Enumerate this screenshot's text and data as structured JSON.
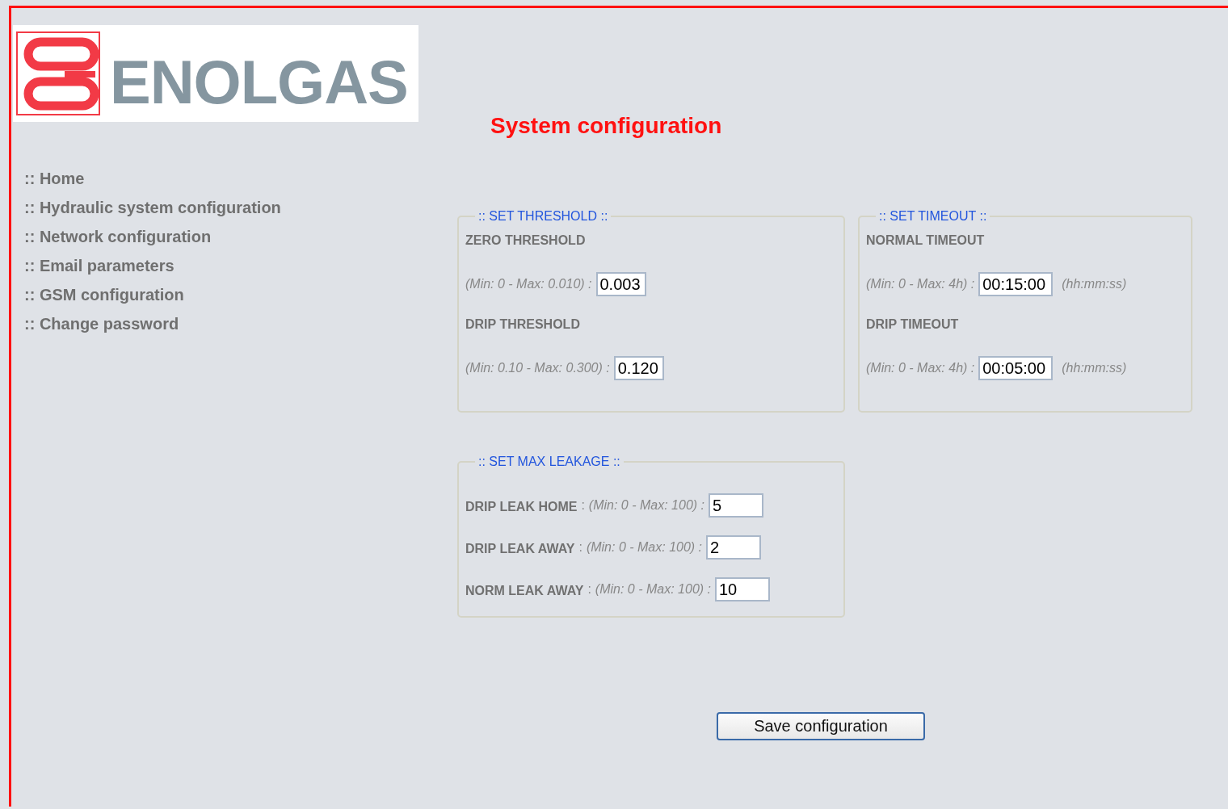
{
  "logo": {
    "text": "ENOLGAS"
  },
  "title": "System configuration",
  "nav": [
    {
      "label": ":: Home"
    },
    {
      "label": ":: Hydraulic system configuration"
    },
    {
      "label": ":: Network configuration"
    },
    {
      "label": ":: Email parameters"
    },
    {
      "label": ":: GSM configuration"
    },
    {
      "label": ":: Change password"
    }
  ],
  "sections": [
    {
      "legend": ":: SET THRESHOLD ::",
      "kind": "stacked",
      "fields": [
        {
          "label": "ZERO THRESHOLD",
          "hint": "(Min: 0 - Max: 0.010) :",
          "value": "0.003"
        },
        {
          "label": "DRIP THRESHOLD",
          "hint": "(Min: 0.10 - Max: 0.300) :",
          "value": "0.120"
        }
      ]
    },
    {
      "legend": ":: SET TIMEOUT ::",
      "kind": "stacked",
      "fields": [
        {
          "label": "NORMAL TIMEOUT",
          "hint": "(Min: 0 - Max: 4h) :",
          "value": "00:15:00",
          "unit": "(hh:mm:ss)"
        },
        {
          "label": "DRIP TIMEOUT",
          "hint": "(Min: 0 - Max: 4h) :",
          "value": "00:05:00",
          "unit": "(hh:mm:ss)"
        }
      ]
    },
    {
      "legend": ":: SET MAX LEAKAGE ::",
      "kind": "inline",
      "fields": [
        {
          "label": "DRIP LEAK HOME",
          "separator": ":",
          "hint": "(Min: 0 - Max: 100) :",
          "value": "5"
        },
        {
          "label": "DRIP LEAK AWAY",
          "separator": ":",
          "hint": "(Min: 0 - Max: 100) :",
          "value": "2"
        },
        {
          "label": "NORM LEAK AWAY",
          "separator": ":",
          "hint": "(Min: 0 - Max: 100) :",
          "value": "10"
        }
      ]
    }
  ],
  "save_button": "Save configuration"
}
